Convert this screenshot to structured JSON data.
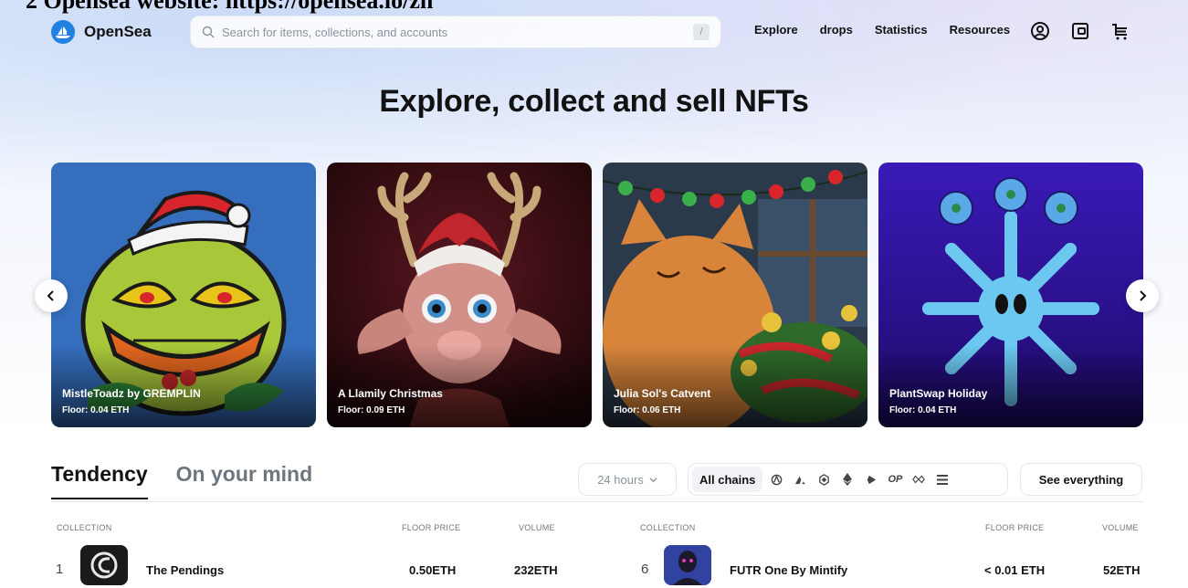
{
  "caption": "2 Opensea website: https://opensea.io/zh",
  "header": {
    "logo_text": "OpenSea",
    "search_placeholder": "Search for items, collections, and accounts",
    "search_shortcut": "/",
    "nav": [
      "Explore",
      "drops",
      "Statistics",
      "Resources"
    ]
  },
  "headline": "Explore, collect and sell NFTs",
  "carousel": [
    {
      "title": "MistleToadz by GREMPLIN",
      "floor": "Floor: 0.04 ETH"
    },
    {
      "title": "A Llamily Christmas",
      "floor": "Floor: 0.09 ETH"
    },
    {
      "title": "Julia Sol's Catvent",
      "floor": "Floor: 0.06 ETH"
    },
    {
      "title": "PlantSwap Holiday",
      "floor": "Floor: 0.04 ETH"
    }
  ],
  "tabs": [
    "Tendency",
    "On your mind"
  ],
  "time_range": "24 hours",
  "chains": {
    "all_label": "All chains",
    "op_label": "OP"
  },
  "see_all": "See everything",
  "table": {
    "headers": {
      "collection": "COLLECTION",
      "floor": "FLOOR PRICE",
      "volume": "VOLUME"
    },
    "rows": [
      {
        "rank": "1",
        "name": "The Pendings",
        "floor": "0.50ETH",
        "volume": "232ETH"
      },
      {
        "rank": "6",
        "name": "FUTR One By Mintify",
        "floor": "< 0.01 ETH",
        "volume": "52ETH"
      }
    ]
  },
  "colors": {
    "brand": "#2081e2",
    "text": "#121212",
    "muted": "#8a939b"
  }
}
